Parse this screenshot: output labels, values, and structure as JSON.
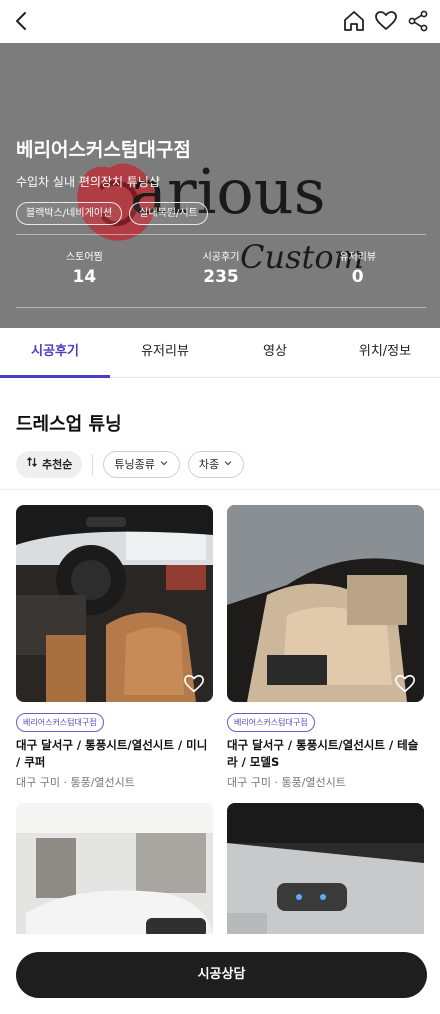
{
  "header": {
    "back_icon": "chevron-left-icon",
    "icons": [
      "home-icon",
      "heart-icon",
      "share-icon"
    ]
  },
  "store": {
    "name": "베리어스커스텀대구점",
    "description": "수입차 실내 편의장치 튜닝샵",
    "tags": [
      "블랙박스/네비게이션",
      "실내복원/시트"
    ],
    "logo_text": "arious",
    "logo_subtext": "Custom",
    "stats": [
      {
        "label": "스토어찜",
        "value": "14"
      },
      {
        "label": "시공후기",
        "value": "235"
      },
      {
        "label": "유저리뷰",
        "value": "0"
      }
    ],
    "hero_color": "#7c7c7c"
  },
  "tabs": [
    {
      "label": "시공후기",
      "active": true
    },
    {
      "label": "유저리뷰",
      "active": false
    },
    {
      "label": "영상",
      "active": false
    },
    {
      "label": "위치/정보",
      "active": false
    }
  ],
  "accent_color": "#4a3ec6",
  "section": {
    "title": "드레스업 튜닝",
    "sort_label": "추천순",
    "filters": [
      "튜닝종류",
      "차종"
    ]
  },
  "cards": [
    {
      "badge": "베리어스커스텀대구점",
      "title": "대구 달서구 / 통풍시트/열선시트 / 미니 / 쿠퍼",
      "meta": "대구 구미 · 통풍/열선시트"
    },
    {
      "badge": "베리어스커스텀대구점",
      "title": "대구 달서구 / 통풍시트/열선시트 / 테슬라 / 모델S",
      "meta": "대구 구미 · 통풍/열선시트"
    },
    {
      "badge": "",
      "title": "",
      "meta": ""
    },
    {
      "badge": "",
      "title": "",
      "meta": ""
    }
  ],
  "cta": {
    "label": "시공상담"
  }
}
